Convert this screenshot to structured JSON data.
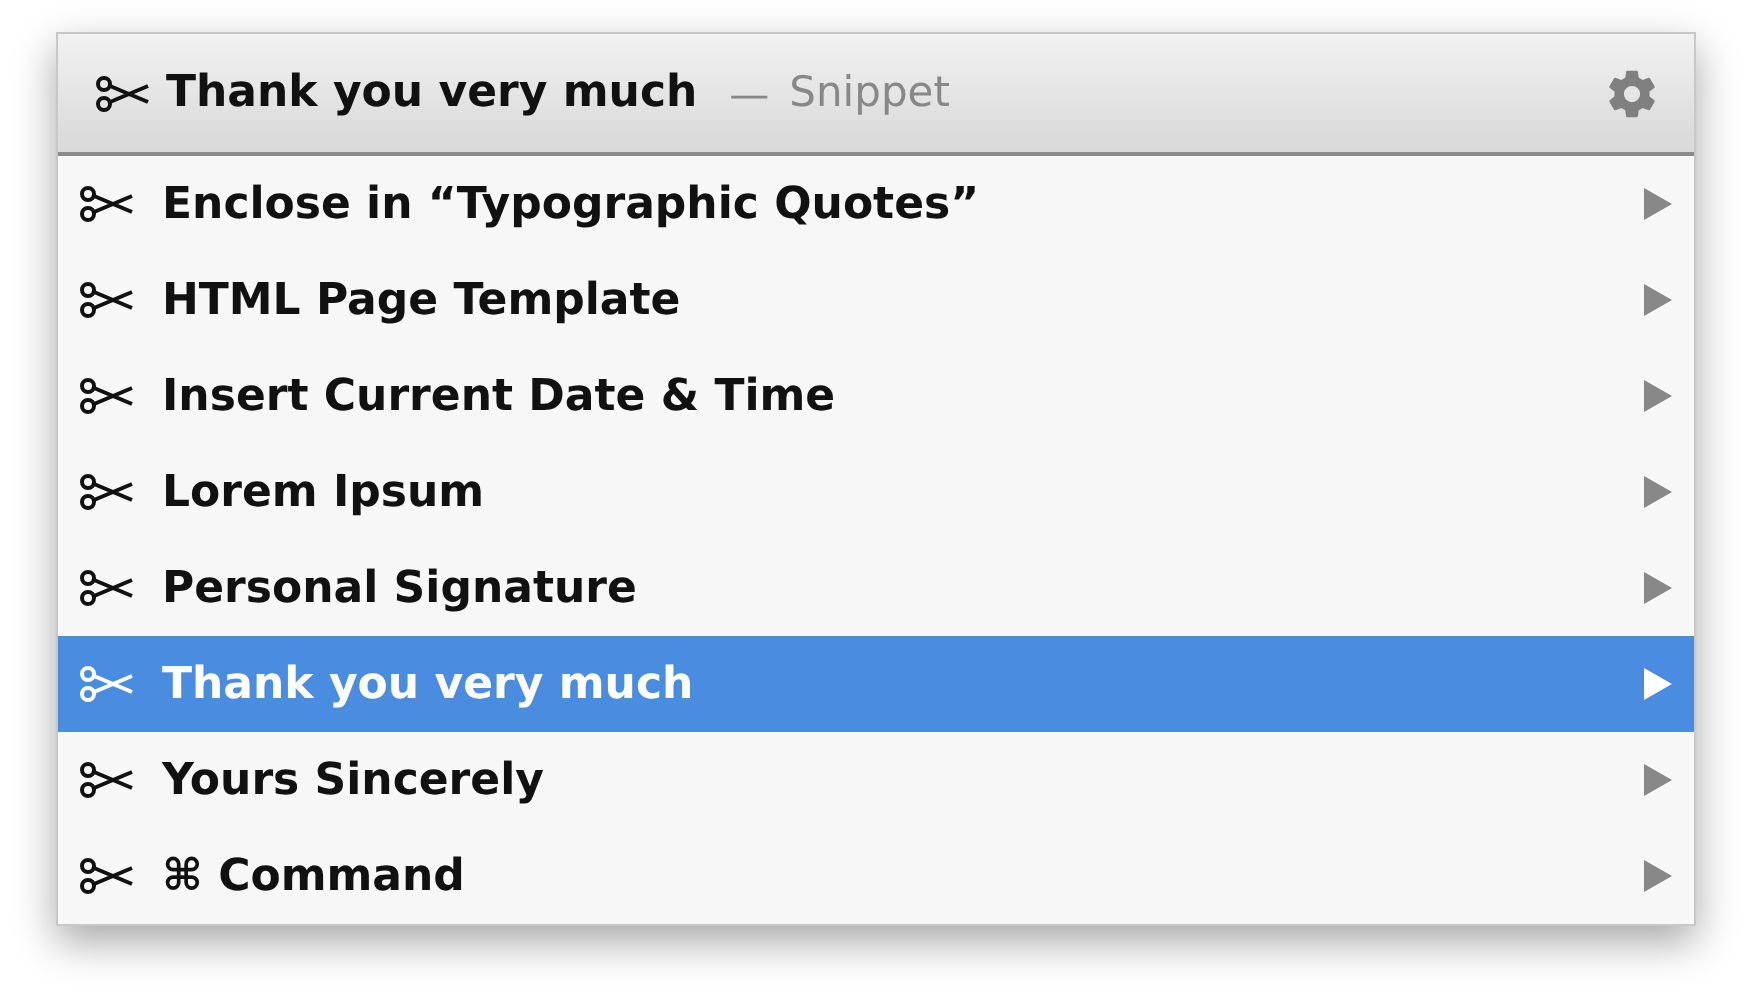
{
  "header": {
    "title": "Thank you very much",
    "separator": "—",
    "subtitle": "Snippet"
  },
  "items": [
    {
      "label": "Enclose in “Typographic Quotes”",
      "selected": false
    },
    {
      "label": "HTML Page Template",
      "selected": false
    },
    {
      "label": "Insert Current Date & Time",
      "selected": false
    },
    {
      "label": "Lorem Ipsum",
      "selected": false
    },
    {
      "label": "Personal Signature",
      "selected": false
    },
    {
      "label": "Thank you very much",
      "selected": true
    },
    {
      "label": "Yours Sincerely",
      "selected": false
    },
    {
      "label": "⌘ Command",
      "selected": false
    }
  ]
}
